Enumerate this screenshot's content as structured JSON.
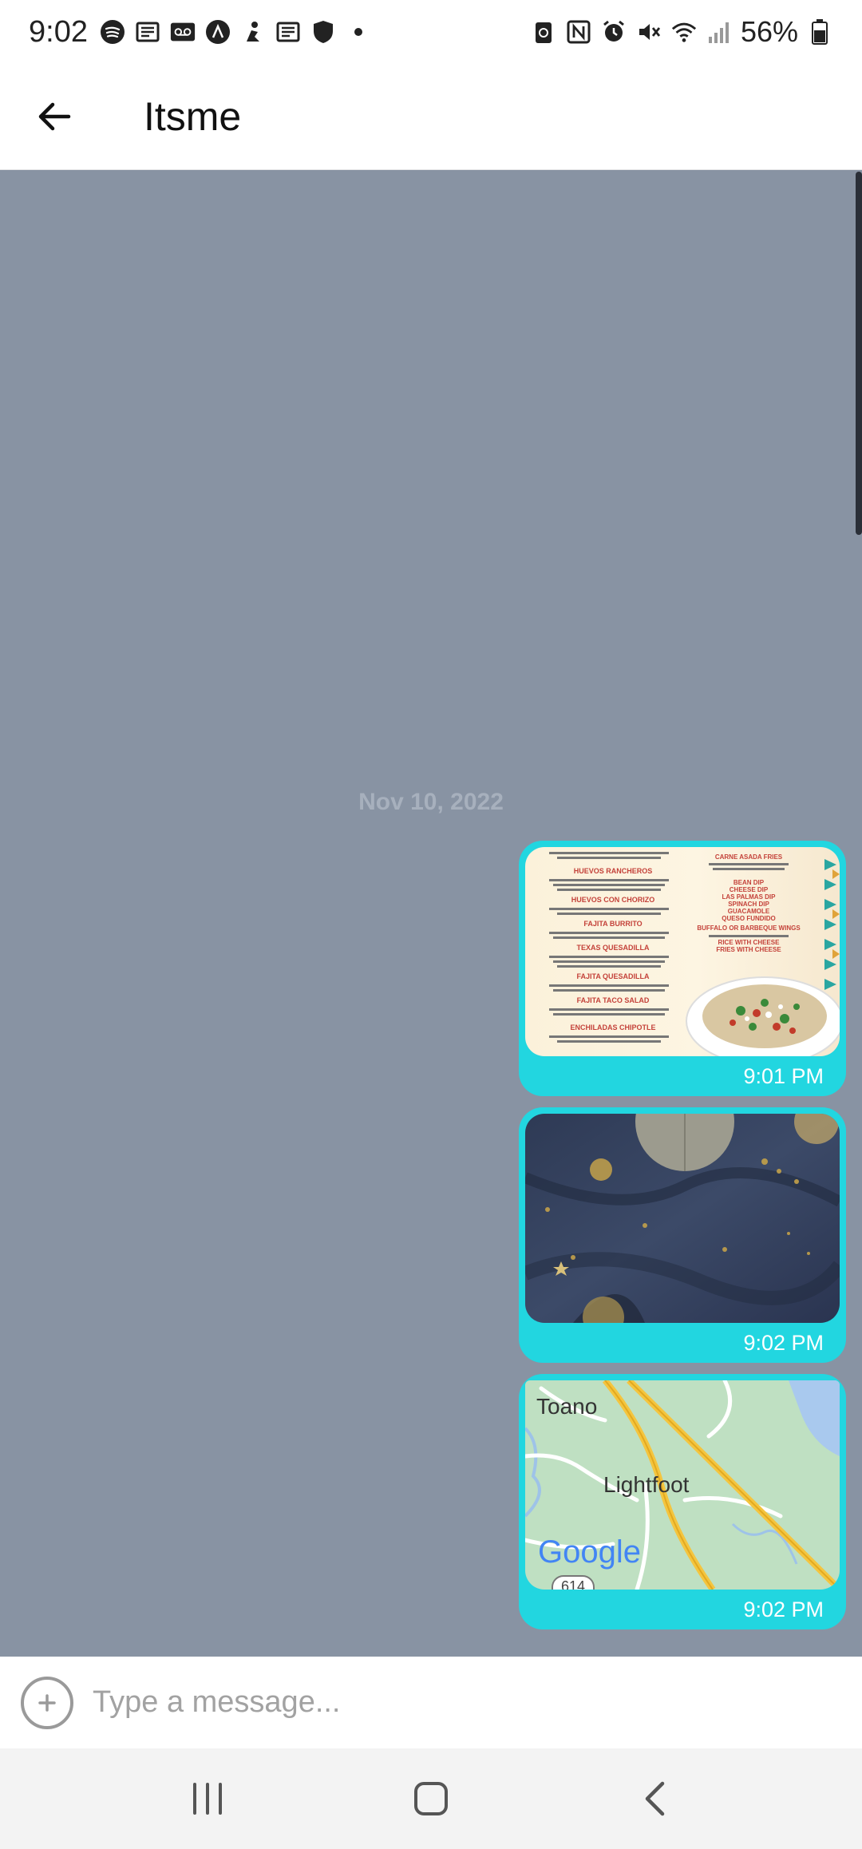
{
  "status_bar": {
    "time": "9:02",
    "battery_percent": "56%",
    "left_icons": [
      "spotify-icon",
      "news-icon",
      "voicemail-icon",
      "app-icon",
      "figure-icon",
      "news-icon",
      "shield-icon",
      "dot-icon"
    ],
    "right_icons": [
      "battery-saver-icon",
      "nfc-icon",
      "alarm-icon",
      "mute-icon",
      "wifi-icon",
      "signal-icon",
      "battery-icon"
    ]
  },
  "header": {
    "title": "Itsme",
    "back_icon": "arrow-left-icon"
  },
  "chat": {
    "date_separator": "Nov 10, 2022",
    "messages": [
      {
        "type": "image",
        "content": "menu-photo",
        "time": "9:01 PM"
      },
      {
        "type": "image",
        "content": "fabric-photo",
        "time": "9:02 PM"
      },
      {
        "type": "map",
        "content": "map-snapshot",
        "time": "9:02 PM"
      }
    ],
    "menu_items": [
      "HUEVOS RANCHEROS",
      "HUEVOS CON CHORIZO",
      "FAJITA BURRITO",
      "TEXAS QUESADILLA",
      "FAJITA QUESADILLA",
      "FAJITA TACO SALAD",
      "ENCHILADAS CHIPOTLE",
      "CARNE ASADA FRIES",
      "BEAN DIP",
      "CHEESE DIP",
      "LAS PALMAS DIP",
      "SPINACH DIP",
      "GUACAMOLE",
      "QUESO FUNDIDO",
      "BUFFALO OR BARBEQUE WINGS",
      "RICE WITH CHEESE",
      "FRIES WITH CHEESE"
    ],
    "map_labels": {
      "town1": "Toano",
      "town2": "Lightfoot",
      "logo": "Google",
      "route": "614"
    }
  },
  "input": {
    "placeholder": "Type a message..."
  },
  "colors": {
    "chat_bg": "#8893a3",
    "bubble": "#22d6e0",
    "date_text": "#a7b0bd"
  }
}
